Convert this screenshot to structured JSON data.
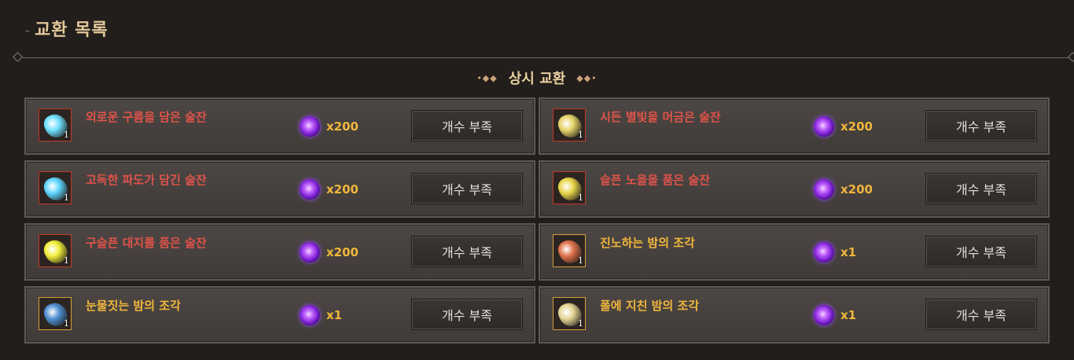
{
  "header": {
    "title": "교환 목록"
  },
  "section": {
    "title": "상시 교환",
    "left_ornament": "•◆◆",
    "right_ornament": "◆◆•"
  },
  "items": [
    {
      "name": "외로운 구름을 담은 술잔",
      "count": "1",
      "cost": "x200",
      "button": "개수 부족",
      "name_color": "red",
      "gem_color": "#6fe0ff"
    },
    {
      "name": "시든 별빛을 머금은 술잔",
      "count": "1",
      "cost": "x200",
      "button": "개수 부족",
      "name_color": "red",
      "gem_color": "#e6d36a"
    },
    {
      "name": "고독한 파도가 담긴 술잔",
      "count": "1",
      "cost": "x200",
      "button": "개수 부족",
      "name_color": "red",
      "gem_color": "#5fd6ff"
    },
    {
      "name": "슬픈 노을을 품은 술잔",
      "count": "1",
      "cost": "x200",
      "button": "개수 부족",
      "name_color": "red",
      "gem_color": "#e8d54a"
    },
    {
      "name": "구슬픈 대지를 품은 술잔",
      "count": "1",
      "cost": "x200",
      "button": "개수 부족",
      "name_color": "red",
      "gem_color": "#f2ee3a"
    },
    {
      "name": "진노하는 밤의 조각",
      "count": "1",
      "cost": "x1",
      "button": "개수 부족",
      "name_color": "gold",
      "gem_color": "#e0714a"
    },
    {
      "name": "눈물짓는 밤의 조각",
      "count": "1",
      "cost": "x1",
      "button": "개수 부족",
      "name_color": "gold",
      "gem_color": "#4f8fd0"
    },
    {
      "name": "폴에 지친 밤의 조각",
      "count": "1",
      "cost": "x1",
      "button": "개수 부족",
      "name_color": "gold",
      "gem_color": "#e4d493"
    }
  ]
}
